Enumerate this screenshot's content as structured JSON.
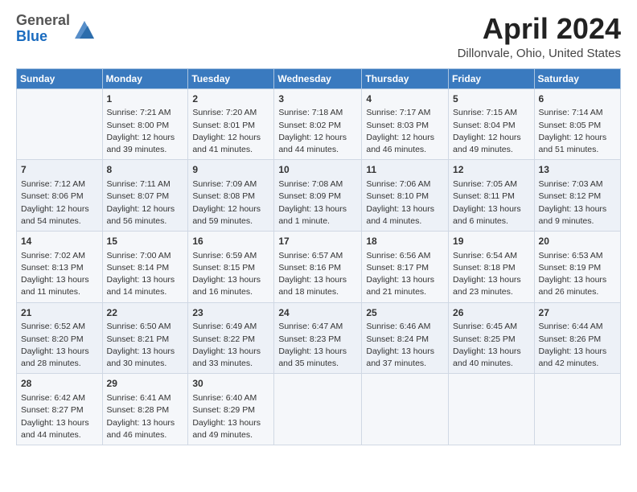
{
  "header": {
    "logo_general": "General",
    "logo_blue": "Blue",
    "month_title": "April 2024",
    "location": "Dillonvale, Ohio, United States"
  },
  "weekdays": [
    "Sunday",
    "Monday",
    "Tuesday",
    "Wednesday",
    "Thursday",
    "Friday",
    "Saturday"
  ],
  "weeks": [
    [
      {
        "day": "",
        "info": ""
      },
      {
        "day": "1",
        "info": "Sunrise: 7:21 AM\nSunset: 8:00 PM\nDaylight: 12 hours and 39 minutes."
      },
      {
        "day": "2",
        "info": "Sunrise: 7:20 AM\nSunset: 8:01 PM\nDaylight: 12 hours and 41 minutes."
      },
      {
        "day": "3",
        "info": "Sunrise: 7:18 AM\nSunset: 8:02 PM\nDaylight: 12 hours and 44 minutes."
      },
      {
        "day": "4",
        "info": "Sunrise: 7:17 AM\nSunset: 8:03 PM\nDaylight: 12 hours and 46 minutes."
      },
      {
        "day": "5",
        "info": "Sunrise: 7:15 AM\nSunset: 8:04 PM\nDaylight: 12 hours and 49 minutes."
      },
      {
        "day": "6",
        "info": "Sunrise: 7:14 AM\nSunset: 8:05 PM\nDaylight: 12 hours and 51 minutes."
      }
    ],
    [
      {
        "day": "7",
        "info": "Sunrise: 7:12 AM\nSunset: 8:06 PM\nDaylight: 12 hours and 54 minutes."
      },
      {
        "day": "8",
        "info": "Sunrise: 7:11 AM\nSunset: 8:07 PM\nDaylight: 12 hours and 56 minutes."
      },
      {
        "day": "9",
        "info": "Sunrise: 7:09 AM\nSunset: 8:08 PM\nDaylight: 12 hours and 59 minutes."
      },
      {
        "day": "10",
        "info": "Sunrise: 7:08 AM\nSunset: 8:09 PM\nDaylight: 13 hours and 1 minute."
      },
      {
        "day": "11",
        "info": "Sunrise: 7:06 AM\nSunset: 8:10 PM\nDaylight: 13 hours and 4 minutes."
      },
      {
        "day": "12",
        "info": "Sunrise: 7:05 AM\nSunset: 8:11 PM\nDaylight: 13 hours and 6 minutes."
      },
      {
        "day": "13",
        "info": "Sunrise: 7:03 AM\nSunset: 8:12 PM\nDaylight: 13 hours and 9 minutes."
      }
    ],
    [
      {
        "day": "14",
        "info": "Sunrise: 7:02 AM\nSunset: 8:13 PM\nDaylight: 13 hours and 11 minutes."
      },
      {
        "day": "15",
        "info": "Sunrise: 7:00 AM\nSunset: 8:14 PM\nDaylight: 13 hours and 14 minutes."
      },
      {
        "day": "16",
        "info": "Sunrise: 6:59 AM\nSunset: 8:15 PM\nDaylight: 13 hours and 16 minutes."
      },
      {
        "day": "17",
        "info": "Sunrise: 6:57 AM\nSunset: 8:16 PM\nDaylight: 13 hours and 18 minutes."
      },
      {
        "day": "18",
        "info": "Sunrise: 6:56 AM\nSunset: 8:17 PM\nDaylight: 13 hours and 21 minutes."
      },
      {
        "day": "19",
        "info": "Sunrise: 6:54 AM\nSunset: 8:18 PM\nDaylight: 13 hours and 23 minutes."
      },
      {
        "day": "20",
        "info": "Sunrise: 6:53 AM\nSunset: 8:19 PM\nDaylight: 13 hours and 26 minutes."
      }
    ],
    [
      {
        "day": "21",
        "info": "Sunrise: 6:52 AM\nSunset: 8:20 PM\nDaylight: 13 hours and 28 minutes."
      },
      {
        "day": "22",
        "info": "Sunrise: 6:50 AM\nSunset: 8:21 PM\nDaylight: 13 hours and 30 minutes."
      },
      {
        "day": "23",
        "info": "Sunrise: 6:49 AM\nSunset: 8:22 PM\nDaylight: 13 hours and 33 minutes."
      },
      {
        "day": "24",
        "info": "Sunrise: 6:47 AM\nSunset: 8:23 PM\nDaylight: 13 hours and 35 minutes."
      },
      {
        "day": "25",
        "info": "Sunrise: 6:46 AM\nSunset: 8:24 PM\nDaylight: 13 hours and 37 minutes."
      },
      {
        "day": "26",
        "info": "Sunrise: 6:45 AM\nSunset: 8:25 PM\nDaylight: 13 hours and 40 minutes."
      },
      {
        "day": "27",
        "info": "Sunrise: 6:44 AM\nSunset: 8:26 PM\nDaylight: 13 hours and 42 minutes."
      }
    ],
    [
      {
        "day": "28",
        "info": "Sunrise: 6:42 AM\nSunset: 8:27 PM\nDaylight: 13 hours and 44 minutes."
      },
      {
        "day": "29",
        "info": "Sunrise: 6:41 AM\nSunset: 8:28 PM\nDaylight: 13 hours and 46 minutes."
      },
      {
        "day": "30",
        "info": "Sunrise: 6:40 AM\nSunset: 8:29 PM\nDaylight: 13 hours and 49 minutes."
      },
      {
        "day": "",
        "info": ""
      },
      {
        "day": "",
        "info": ""
      },
      {
        "day": "",
        "info": ""
      },
      {
        "day": "",
        "info": ""
      }
    ]
  ]
}
